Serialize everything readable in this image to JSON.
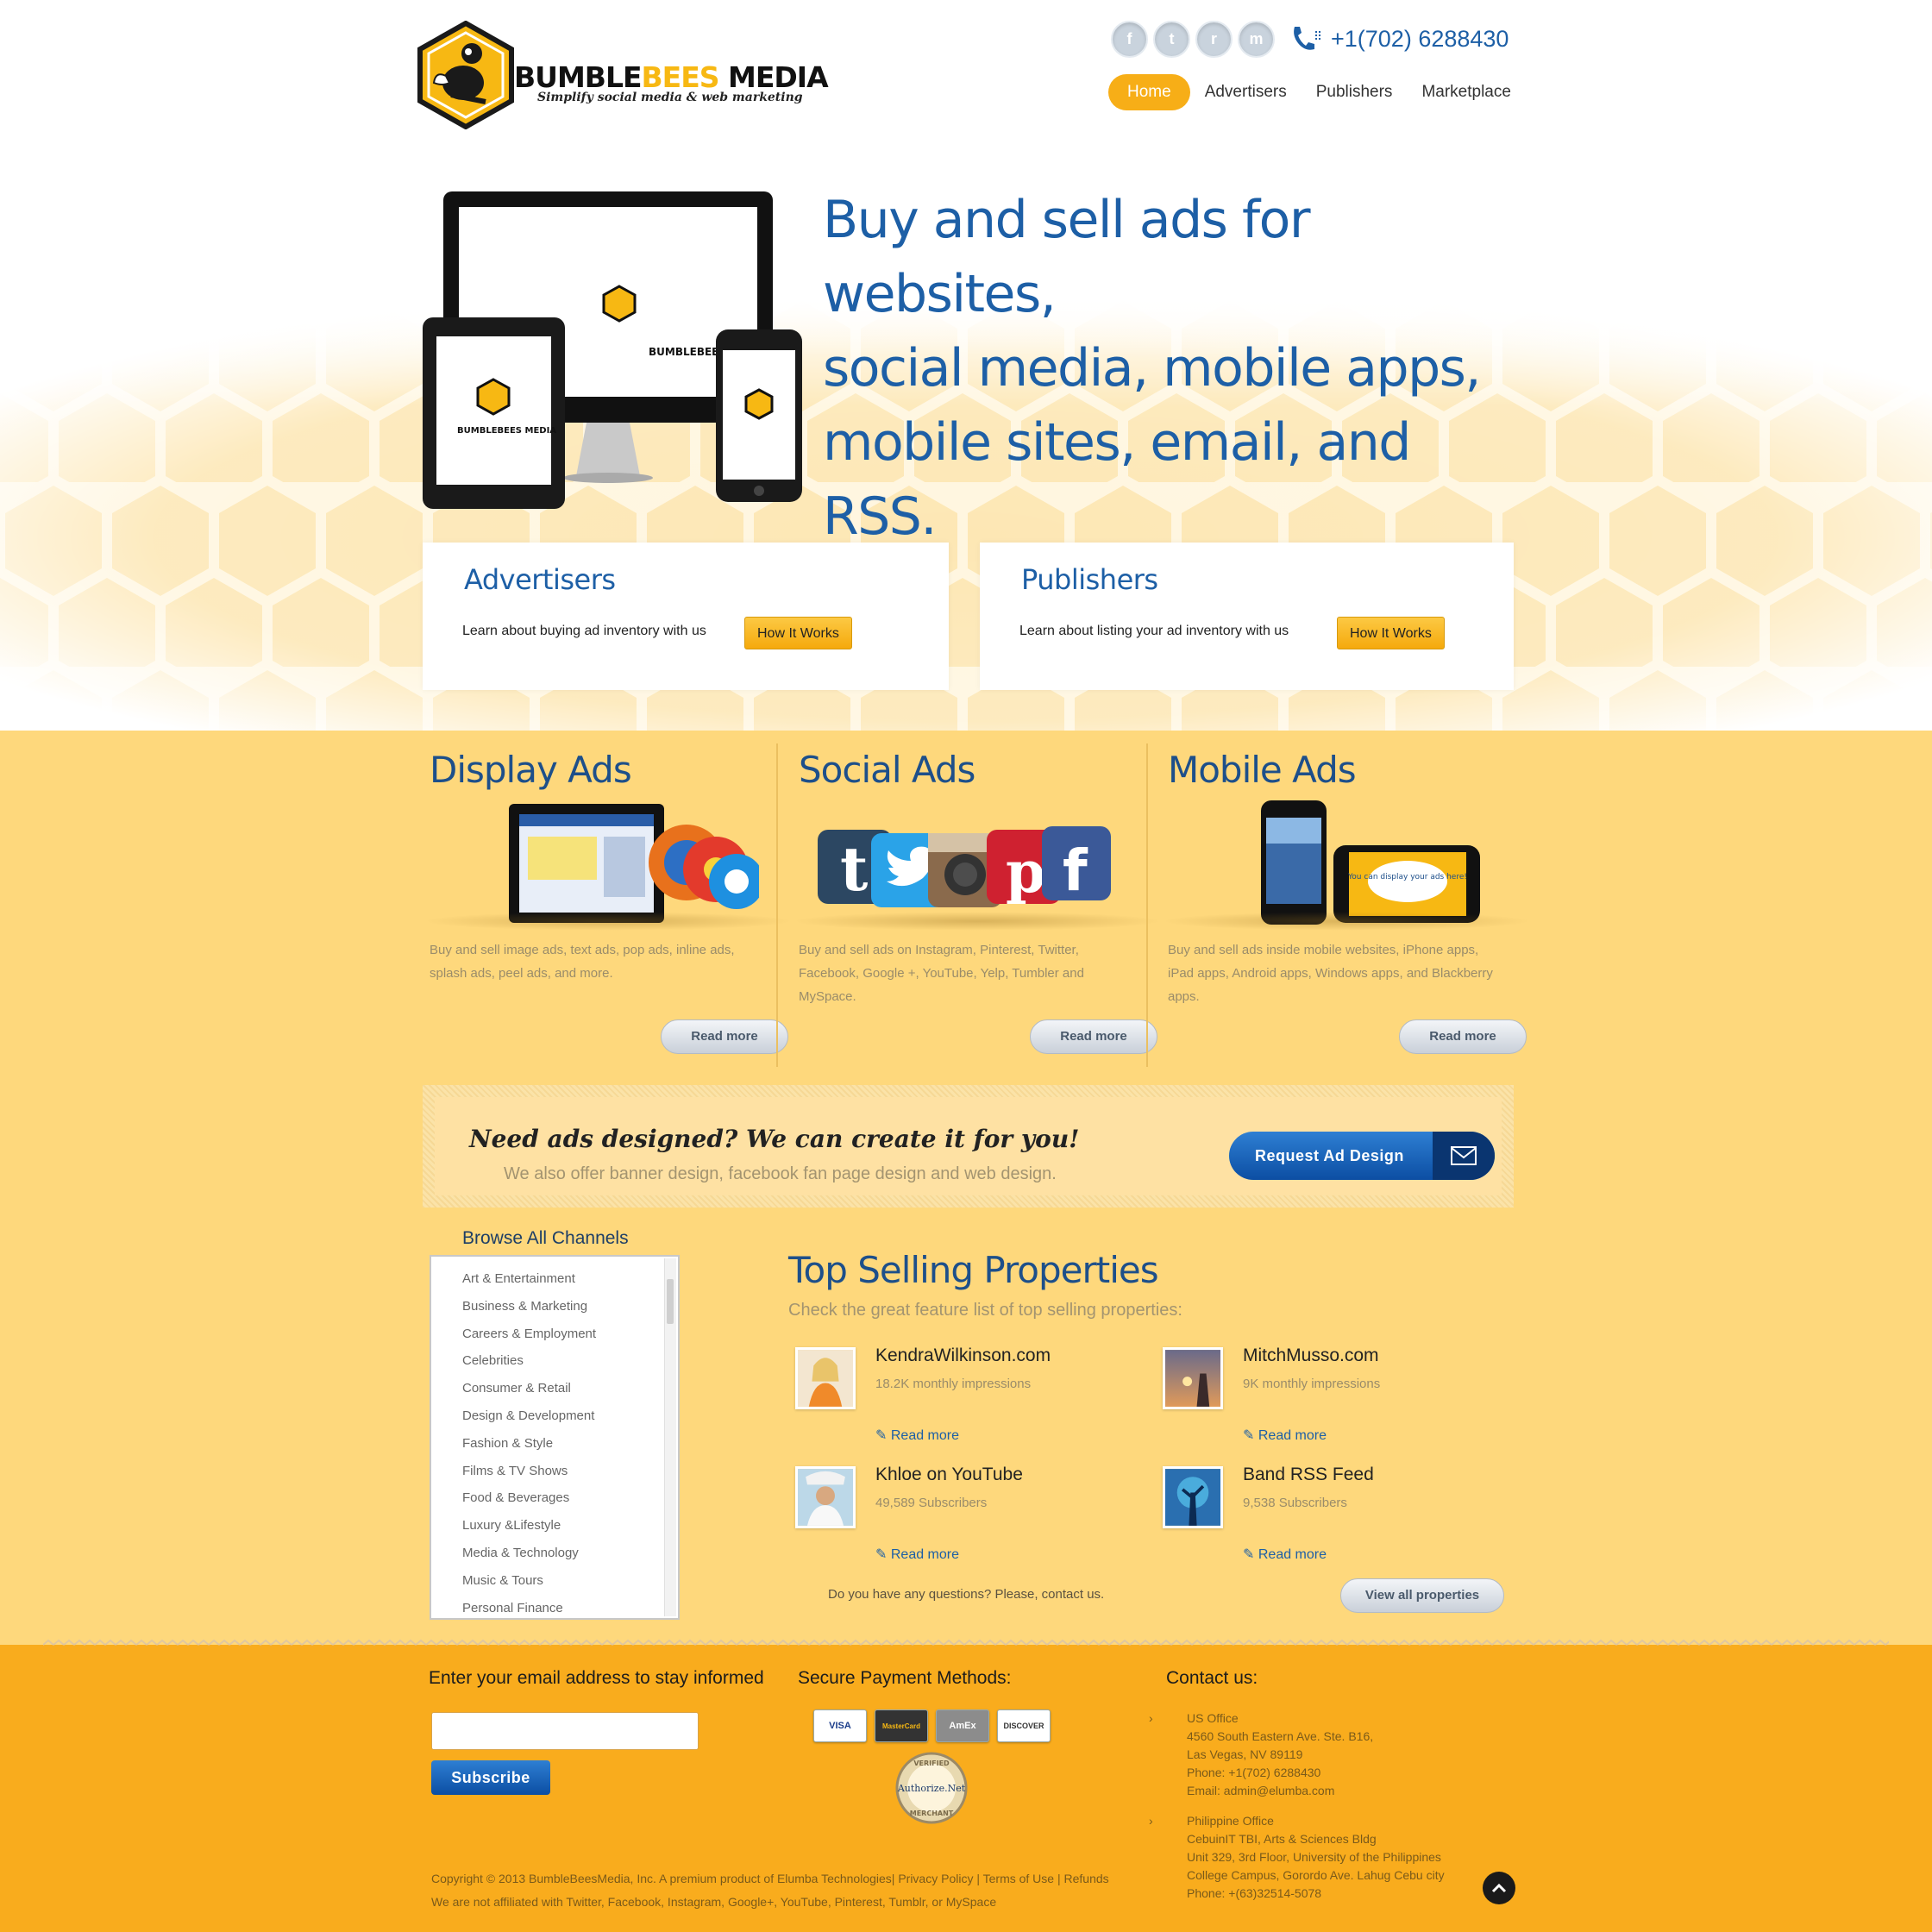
{
  "brand": {
    "name_dark_1": "BUMBLE",
    "name_yellow": "BEES",
    "name_dark_2": " MEDIA",
    "tagline": "Simplify social media & web marketing",
    "screen_logo": "BUMBLEBEES MEDIA"
  },
  "header": {
    "social_icons": [
      "facebook-icon",
      "twitter-icon",
      "rss-icon",
      "myspace-icon"
    ],
    "social_glyphs": [
      "f",
      "t",
      "r",
      "m"
    ],
    "phone": "+1(702) 6288430",
    "nav": [
      {
        "label": "Home",
        "active": true
      },
      {
        "label": "Advertisers"
      },
      {
        "label": "Publishers"
      },
      {
        "label": "Marketplace"
      }
    ]
  },
  "hero": {
    "headline_lines": [
      "Buy and sell ads for websites,",
      "social media, mobile apps,",
      "mobile sites, email, and RSS."
    ],
    "advertisers": {
      "title": "Advertisers",
      "text": "Learn about buying ad inventory with us",
      "button": "How It Works"
    },
    "publishers": {
      "title": "Publishers",
      "text": "Learn about listing your ad inventory with us",
      "button": "How It Works"
    }
  },
  "features": [
    {
      "title": "Display Ads",
      "text": "Buy and sell image ads, text ads, pop ads, inline ads, splash ads, peel ads, and more.",
      "button": "Read more"
    },
    {
      "title": "Social Ads",
      "text": "Buy and sell ads on Instagram, Pinterest, Twitter, Facebook, Google +, YouTube, Yelp, Tumbler and MySpace.",
      "button": "Read more"
    },
    {
      "title": "Mobile Ads",
      "text": "Buy and sell ads inside mobile websites, iPhone apps, iPad apps, Android apps, Windows apps, and Blackberry apps.",
      "button": "Read more"
    }
  ],
  "mobile_bubble": "You can display your ads here!",
  "banner": {
    "heading": "Need ads designed? We can create it for you!",
    "sub": "We also offer banner design, facebook fan page design and web design.",
    "button": "Request Ad Design"
  },
  "channels": {
    "title": "Browse All Channels",
    "items": [
      "Art & Entertainment",
      "Business & Marketing",
      "Careers & Employment",
      "Celebrities",
      "Consumer & Retail",
      "Design & Development",
      "Fashion & Style",
      "Films & TV Shows",
      "Food & Beverages",
      "Luxury &Lifestyle",
      "Media & Technology",
      "Music & Tours",
      "Personal Finance"
    ]
  },
  "top_selling": {
    "title": "Top Selling Properties",
    "subtitle": "Check the great feature list of top selling properties:",
    "items": [
      {
        "name": "KendraWilkinson.com",
        "stat": "18.2K monthly impressions",
        "link": "Read more"
      },
      {
        "name": "MitchMusso.com",
        "stat": "9K monthly impressions",
        "link": "Read more"
      },
      {
        "name": "Khloe on YouTube",
        "stat": "49,589 Subscribers",
        "link": "Read more"
      },
      {
        "name": "Band RSS Feed",
        "stat": "9,538 Subscribers",
        "link": "Read more"
      }
    ],
    "question": "Do you have any questions? Please, contact us.",
    "view_all": "View all properties"
  },
  "footer": {
    "newsletter_title": "Enter your email address to stay informed",
    "email_value": "",
    "subscribe": "Subscribe",
    "payment_title": "Secure Payment Methods:",
    "cards": [
      "VISA",
      "MasterCard",
      "AmEx",
      "DISCOVER"
    ],
    "seal": {
      "top": "VERIFIED",
      "name": "Authorize.Net",
      "bottom": "MERCHANT"
    },
    "contact_title": "Contact us:",
    "us_office": {
      "title": "US Office",
      "lines": [
        "4560 South Eastern Ave. Ste. B16,",
        "Las Vegas, NV 89119",
        "Phone: +1(702) 6288430",
        "Email: admin@elumba.com"
      ]
    },
    "ph_office": {
      "title": "Philippine Office",
      "lines": [
        "CebuinIT TBI, Arts & Sciences Bldg",
        "Unit 329, 3rd Floor, University of the Philippines",
        "College Campus, Gorordo Ave. Lahug Cebu city",
        "Phone: +(63)32514-5078"
      ]
    },
    "copyright_line1": "Copyright © 2013 BumbleBeesMedia, Inc. A premium product of Elumba Technologies|  Privacy Policy  |  Terms of Use  |  Refunds",
    "copyright_line2": "We are not affiliated with Twitter, Facebook, Instagram, Google+, YouTube, Pinterest, Tumblr, or MySpace"
  },
  "colors": {
    "accent": "#f7ae17",
    "blue": "#1d5fa6",
    "mid_bg": "#fed87c",
    "footer_bg": "#f9ac1d"
  }
}
